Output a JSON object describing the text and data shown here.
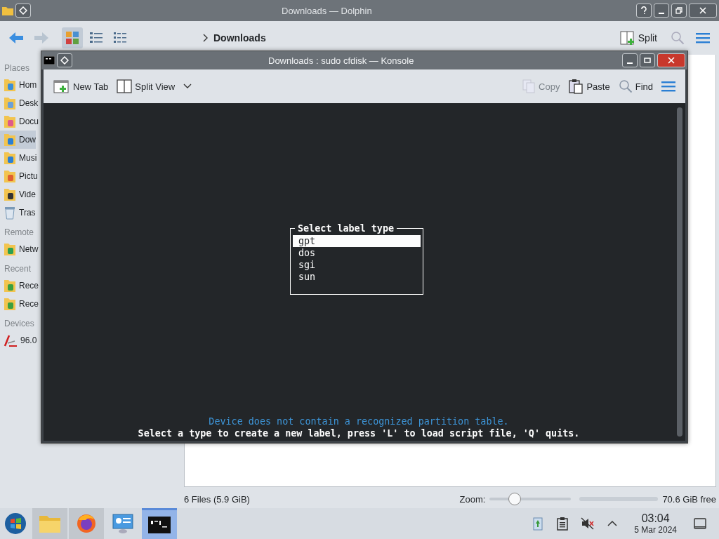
{
  "dolphin": {
    "title": "Downloads — Dolphin",
    "view_modes": [
      {
        "selected": true
      },
      {
        "selected": false
      },
      {
        "selected": false
      }
    ],
    "breadcrumb": "Downloads",
    "split": "Split",
    "sidebar": [
      {
        "heading": "Places",
        "items": [
          {
            "kind": "home",
            "label": "Hom",
            "selected": false
          },
          {
            "kind": "desktop",
            "label": "Desk",
            "selected": false
          },
          {
            "kind": "documents",
            "label": "Docu",
            "selected": false
          },
          {
            "kind": "downloads",
            "label": "Dow",
            "selected": true
          },
          {
            "kind": "music",
            "label": "Musi",
            "selected": false
          },
          {
            "kind": "pictures",
            "label": "Pictu",
            "selected": false
          },
          {
            "kind": "videos",
            "label": "Vide",
            "selected": false
          },
          {
            "kind": "trash",
            "label": "Tras",
            "selected": false
          }
        ]
      },
      {
        "heading": "Remote",
        "items": [
          {
            "kind": "network",
            "label": "Netw",
            "selected": false
          }
        ]
      },
      {
        "heading": "Recent",
        "items": [
          {
            "kind": "recent-files",
            "label": "Rece",
            "selected": false
          },
          {
            "kind": "recent-locations",
            "label": "Rece",
            "selected": false
          }
        ]
      },
      {
        "heading": "Devices",
        "items": [
          {
            "kind": "drive",
            "label": "96.0",
            "selected": false
          }
        ]
      }
    ],
    "status": {
      "files": "6 Files (5.9 GiB)",
      "zoom_label": "Zoom:",
      "zoom": {
        "level": 0.3
      },
      "free": "70.6 GiB free"
    }
  },
  "konsole": {
    "title": "Downloads : sudo cfdisk — Konsole",
    "toolbar": [
      {
        "kind": "new-tab",
        "label": "New Tab",
        "disabled": false
      },
      {
        "kind": "split-view",
        "label": "Split View",
        "disabled": false
      },
      {
        "kind": "copy",
        "label": "Copy",
        "disabled": true
      },
      {
        "kind": "paste",
        "label": "Paste",
        "disabled": false
      },
      {
        "kind": "find",
        "label": "Find",
        "disabled": false
      },
      {
        "kind": "menu",
        "disabled": false
      }
    ],
    "dialog": {
      "title": "Select label type",
      "options": [
        {
          "label": "gpt",
          "selected": true
        },
        {
          "label": "dos",
          "selected": false
        },
        {
          "label": "sgi",
          "selected": false
        },
        {
          "label": "sun",
          "selected": false
        }
      ]
    },
    "message": "Device does not contain a recognized partition table.",
    "hint": "Select a type to create a new label, press 'L' to load script file, 'Q' quits."
  },
  "taskbar": {
    "apps": [
      {
        "kind": "files",
        "running": true,
        "selected": false
      },
      {
        "kind": "browser",
        "running": true,
        "selected": false
      },
      {
        "kind": "settings",
        "running": false,
        "selected": false
      },
      {
        "kind": "terminal",
        "running": true,
        "selected": true
      }
    ],
    "clock": {
      "time": "03:04",
      "date": "5 Mar 2024"
    }
  }
}
